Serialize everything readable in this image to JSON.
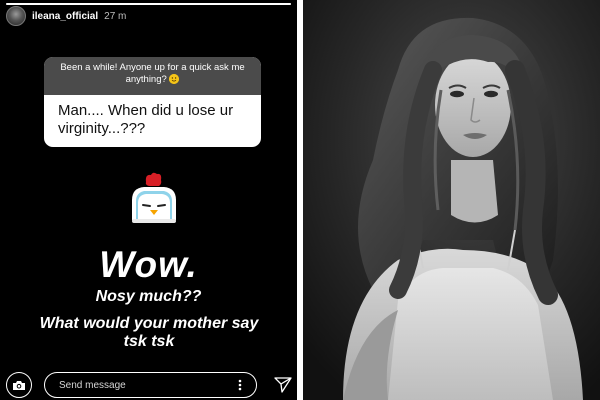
{
  "story": {
    "progress_fraction": 1.0,
    "user": {
      "username": "ileana_official",
      "time": "27 m"
    },
    "question_sticker": {
      "prompt": "Been a while! Anyone up for a quick ask me anything?",
      "emoji_icon": "smiling-face-emoji",
      "answer": "Man.... When did u lose ur virginity...???"
    },
    "sticker_icon": "chicken-emoji",
    "reply": {
      "line1": "Wow.",
      "line2": "Nosy much??",
      "line3": "What would your mother say tsk tsk"
    },
    "footer": {
      "camera_icon": "camera-icon",
      "send_message_placeholder": "Send message",
      "more_icon": "more-options-icon",
      "send_icon": "paper-plane-icon"
    }
  },
  "photo": {
    "kind": "black-and-white portrait photo"
  },
  "colors": {
    "story_background": "#000000",
    "prompt_header": "#4b4b4b",
    "card": "#ffffff"
  }
}
